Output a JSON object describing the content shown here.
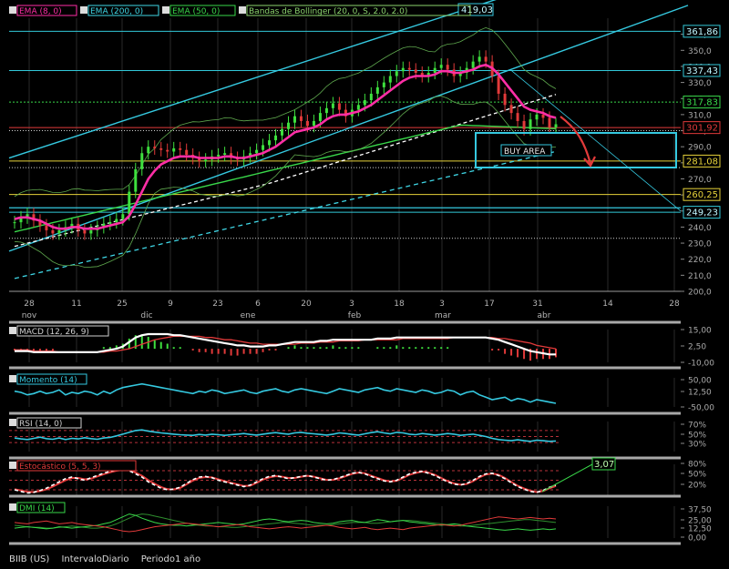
{
  "chart_data": [
    {
      "type": "line",
      "symbol": "BIIB (US)",
      "interval": "IntervaloDiario",
      "period": "Periodo1 año",
      "legend": [
        "EMA (8, 0)",
        "EMA (200, 0)",
        "EMA (50, 0)",
        "Bandas de Bollinger (20, 0, S, 2.0, 2.0)"
      ],
      "legend_colors": [
        "#ff2ea6",
        "#3fd7e6",
        "#39d84a",
        "#8bd36e"
      ],
      "ylim": [
        200,
        370
      ],
      "y_ticks": [
        200,
        210,
        220,
        230,
        240,
        250,
        260,
        270,
        280,
        290,
        300,
        310,
        320,
        330,
        340,
        350,
        360
      ],
      "x_ticks": [
        "28",
        "11",
        "25",
        "9",
        "23",
        "6",
        "20",
        "3",
        "18",
        "3",
        "17",
        "31",
        "14",
        "28"
      ],
      "month_labels": [
        "nov",
        "dic",
        "ene",
        "feb",
        "mar",
        "abr"
      ],
      "price_close": [
        243,
        246,
        248,
        244,
        241,
        238,
        236,
        238,
        240,
        242,
        238,
        236,
        238,
        240,
        242,
        243,
        245,
        248,
        262,
        276,
        286,
        290,
        289,
        288,
        287,
        289,
        288,
        285,
        283,
        281,
        282,
        284,
        285,
        286,
        283,
        282,
        284,
        286,
        288,
        291,
        294,
        297,
        301,
        305,
        309,
        306,
        303,
        306,
        311,
        314,
        317,
        313,
        309,
        313,
        316,
        319,
        323,
        327,
        330,
        334,
        337,
        339,
        338,
        336,
        334,
        336,
        339,
        341,
        338,
        334,
        336,
        339,
        343,
        346,
        343,
        334,
        323,
        316,
        311,
        306,
        301,
        307,
        310,
        308,
        302,
        304
      ],
      "ema8": [
        245,
        246,
        246,
        245,
        244,
        242,
        240,
        239,
        239,
        240,
        240,
        239,
        239,
        239,
        240,
        241,
        242,
        243,
        247,
        254,
        262,
        270,
        275,
        279,
        281,
        283,
        284,
        284,
        284,
        283,
        283,
        283,
        283,
        284,
        284,
        283,
        283,
        284,
        285,
        286,
        288,
        290,
        293,
        296,
        299,
        300,
        301,
        302,
        304,
        307,
        309,
        310,
        310,
        311,
        312,
        314,
        316,
        319,
        322,
        325,
        328,
        331,
        333,
        334,
        334,
        334,
        335,
        337,
        337,
        336,
        336,
        337,
        338,
        340,
        341,
        339,
        335,
        330,
        325,
        320,
        315,
        313,
        312,
        311,
        309,
        308
      ],
      "levels": [
        {
          "label": "361,86",
          "value": 361.86,
          "color": "#32c8d8"
        },
        {
          "label": "337,43",
          "value": 337.43,
          "color": "#32c8d8"
        },
        {
          "label": "317,83",
          "value": 317.83,
          "color": "#39d84a"
        },
        {
          "label": "301,92",
          "value": 301.92,
          "color": "#e23a3a"
        },
        {
          "label": "281,08",
          "value": 281.08,
          "color": "#e6d23a"
        },
        {
          "label": "260,25",
          "value": 260.25,
          "color": "#e6d23a"
        },
        {
          "label": "249,23",
          "value": 249.23,
          "color": "#32c8d8"
        }
      ],
      "trend_label": "419,03",
      "annotation": "BUY AREA"
    },
    {
      "type": "line",
      "legend": [
        "MACD (12, 26, 9)"
      ],
      "y_ticks": [
        "15,00",
        "2,50",
        "-10,00"
      ],
      "ylim": [
        -12,
        17
      ],
      "macd": [
        -2,
        -2,
        -2,
        -3,
        -3,
        -3,
        -3,
        -3,
        -3,
        -3,
        -3,
        -3,
        -3,
        -3,
        -2,
        -1,
        0,
        2,
        6,
        10,
        12,
        13,
        13,
        13,
        13,
        12,
        12,
        11,
        10,
        9,
        8,
        7,
        6,
        5,
        4,
        3,
        3,
        2,
        2,
        2,
        3,
        3,
        4,
        5,
        6,
        6,
        6,
        6,
        7,
        7,
        8,
        8,
        8,
        8,
        8,
        8,
        8,
        9,
        9,
        9,
        10,
        10,
        10,
        10,
        10,
        10,
        10,
        10,
        10,
        10,
        10,
        10,
        10,
        10,
        10,
        9,
        8,
        6,
        4,
        2,
        0,
        -2,
        -3,
        -4,
        -5,
        -5
      ],
      "signal": [
        -1,
        -1,
        -1,
        -2,
        -2,
        -2,
        -2,
        -3,
        -3,
        -3,
        -3,
        -3,
        -3,
        -3,
        -3,
        -2,
        -2,
        -1,
        0,
        2,
        4,
        6,
        8,
        9,
        10,
        11,
        11,
        11,
        11,
        11,
        10,
        10,
        9,
        8,
        8,
        7,
        6,
        5,
        5,
        4,
        4,
        4,
        4,
        4,
        4,
        5,
        5,
        5,
        6,
        6,
        6,
        7,
        7,
        7,
        7,
        8,
        8,
        8,
        8,
        8,
        8,
        9,
        9,
        9,
        9,
        9,
        9,
        9,
        9,
        10,
        10,
        10,
        10,
        10,
        10,
        10,
        9,
        9,
        8,
        7,
        6,
        5,
        3,
        2,
        1,
        0
      ]
    },
    {
      "type": "line",
      "legend": [
        "Momento (14)"
      ],
      "y_ticks": [
        "50,00",
        "12,50",
        "-50,00"
      ],
      "ylim": [
        -60,
        60
      ],
      "values": [
        5,
        0,
        -10,
        -5,
        5,
        -5,
        0,
        10,
        -10,
        0,
        -5,
        5,
        0,
        -10,
        5,
        -5,
        10,
        20,
        25,
        30,
        35,
        30,
        25,
        20,
        15,
        10,
        5,
        0,
        -5,
        5,
        0,
        10,
        5,
        -5,
        0,
        5,
        10,
        0,
        -5,
        5,
        10,
        15,
        5,
        0,
        10,
        15,
        10,
        5,
        0,
        -5,
        5,
        15,
        10,
        5,
        0,
        10,
        15,
        20,
        10,
        5,
        15,
        10,
        5,
        0,
        10,
        5,
        -5,
        0,
        10,
        5,
        -10,
        0,
        5,
        -10,
        -20,
        -30,
        -25,
        -20,
        -35,
        -25,
        -30,
        -40,
        -30,
        -35,
        -40,
        -45
      ]
    },
    {
      "type": "line",
      "legend": [
        "RSI (14, 0)"
      ],
      "y_ticks": [
        "70%",
        "50%",
        "30%"
      ],
      "ylim": [
        0,
        100
      ],
      "values": [
        45,
        42,
        40,
        44,
        48,
        43,
        41,
        45,
        40,
        44,
        42,
        46,
        43,
        41,
        45,
        47,
        52,
        58,
        64,
        70,
        72,
        68,
        65,
        62,
        60,
        58,
        56,
        55,
        54,
        57,
        55,
        58,
        56,
        54,
        56,
        58,
        60,
        57,
        55,
        58,
        61,
        63,
        60,
        58,
        62,
        64,
        61,
        59,
        57,
        55,
        58,
        62,
        60,
        57,
        55,
        59,
        63,
        66,
        62,
        59,
        64,
        62,
        58,
        56,
        60,
        58,
        55,
        57,
        60,
        58,
        54,
        56,
        58,
        54,
        50,
        44,
        40,
        38,
        36,
        39,
        36,
        34,
        38,
        36,
        34,
        35
      ]
    },
    {
      "type": "line",
      "legend": [
        "Estocástico (5, 5, 3)"
      ],
      "y_ticks": [
        "80%",
        "50%",
        "20%"
      ],
      "ylim": [
        0,
        100
      ],
      "k": [
        20,
        15,
        10,
        12,
        18,
        25,
        35,
        45,
        55,
        60,
        55,
        50,
        58,
        65,
        72,
        78,
        82,
        85,
        80,
        70,
        60,
        45,
        35,
        25,
        20,
        22,
        28,
        40,
        52,
        60,
        62,
        58,
        50,
        45,
        40,
        35,
        30,
        35,
        45,
        55,
        62,
        65,
        60,
        55,
        58,
        62,
        65,
        60,
        55,
        50,
        52,
        58,
        65,
        72,
        75,
        70,
        62,
        55,
        48,
        45,
        50,
        60,
        70,
        75,
        78,
        72,
        65,
        55,
        45,
        38,
        35,
        40,
        50,
        62,
        70,
        72,
        65,
        55,
        42,
        30,
        22,
        15,
        12,
        18,
        28,
        35
      ],
      "d": [
        22,
        18,
        14,
        13,
        16,
        21,
        30,
        40,
        50,
        57,
        57,
        53,
        55,
        62,
        69,
        75,
        80,
        83,
        82,
        74,
        64,
        50,
        39,
        29,
        22,
        21,
        26,
        37,
        49,
        57,
        60,
        59,
        53,
        47,
        42,
        37,
        32,
        33,
        42,
        52,
        59,
        63,
        61,
        57,
        57,
        61,
        64,
        61,
        56,
        51,
        51,
        56,
        63,
        70,
        74,
        72,
        64,
        57,
        50,
        46,
        48,
        57,
        67,
        73,
        77,
        74,
        67,
        57,
        47,
        40,
        36,
        38,
        47,
        59,
        68,
        71,
        67,
        57,
        45,
        33,
        24,
        17,
        13,
        16,
        25,
        32
      ],
      "callout": "3,07"
    },
    {
      "type": "line",
      "legend": [
        "DMI (14)"
      ],
      "y_ticks": [
        "37,50",
        "25,00",
        "12,50",
        "0,00"
      ],
      "ylim": [
        0,
        45
      ],
      "adx": [
        18,
        17,
        16,
        15,
        15,
        14,
        14,
        15,
        16,
        17,
        16,
        15,
        14,
        14,
        15,
        17,
        20,
        24,
        28,
        32,
        34,
        33,
        31,
        29,
        27,
        25,
        23,
        21,
        19,
        18,
        17,
        17,
        16,
        16,
        15,
        15,
        16,
        17,
        18,
        19,
        20,
        21,
        22,
        22,
        21,
        20,
        19,
        18,
        18,
        18,
        19,
        20,
        21,
        22,
        22,
        22,
        21,
        21,
        22,
        23,
        24,
        25,
        25,
        24,
        23,
        22,
        21,
        20,
        19,
        18,
        17,
        17,
        18,
        19,
        20,
        21,
        22,
        23,
        24,
        25,
        26,
        26,
        25,
        24,
        23,
        22
      ],
      "plus_di": [
        14,
        15,
        16,
        15,
        14,
        13,
        14,
        16,
        15,
        14,
        15,
        16,
        17,
        18,
        20,
        22,
        26,
        30,
        34,
        32,
        28,
        25,
        22,
        20,
        19,
        18,
        18,
        17,
        18,
        19,
        20,
        21,
        22,
        21,
        20,
        19,
        20,
        22,
        24,
        26,
        27,
        26,
        24,
        23,
        24,
        25,
        24,
        22,
        21,
        20,
        21,
        23,
        24,
        25,
        23,
        22,
        24,
        26,
        25,
        23,
        24,
        25,
        23,
        22,
        21,
        20,
        19,
        18,
        19,
        20,
        19,
        17,
        16,
        15,
        14,
        13,
        12,
        11,
        12,
        13,
        12,
        11,
        12,
        13,
        12,
        13
      ],
      "minus_di": [
        22,
        21,
        20,
        22,
        23,
        24,
        22,
        20,
        21,
        22,
        20,
        19,
        18,
        17,
        16,
        14,
        12,
        10,
        9,
        10,
        12,
        14,
        16,
        17,
        18,
        19,
        20,
        21,
        20,
        19,
        18,
        17,
        16,
        17,
        18,
        19,
        18,
        16,
        15,
        14,
        13,
        14,
        15,
        16,
        15,
        14,
        15,
        16,
        17,
        18,
        17,
        15,
        14,
        13,
        14,
        15,
        13,
        12,
        13,
        14,
        13,
        12,
        14,
        15,
        16,
        17,
        18,
        19,
        18,
        17,
        18,
        20,
        22,
        24,
        26,
        28,
        30,
        29,
        28,
        27,
        28,
        29,
        28,
        27,
        28,
        27
      ]
    }
  ],
  "footer": {
    "symbol": "BIIB (US)",
    "interval": "IntervaloDiario",
    "period": "Periodo1 año"
  }
}
